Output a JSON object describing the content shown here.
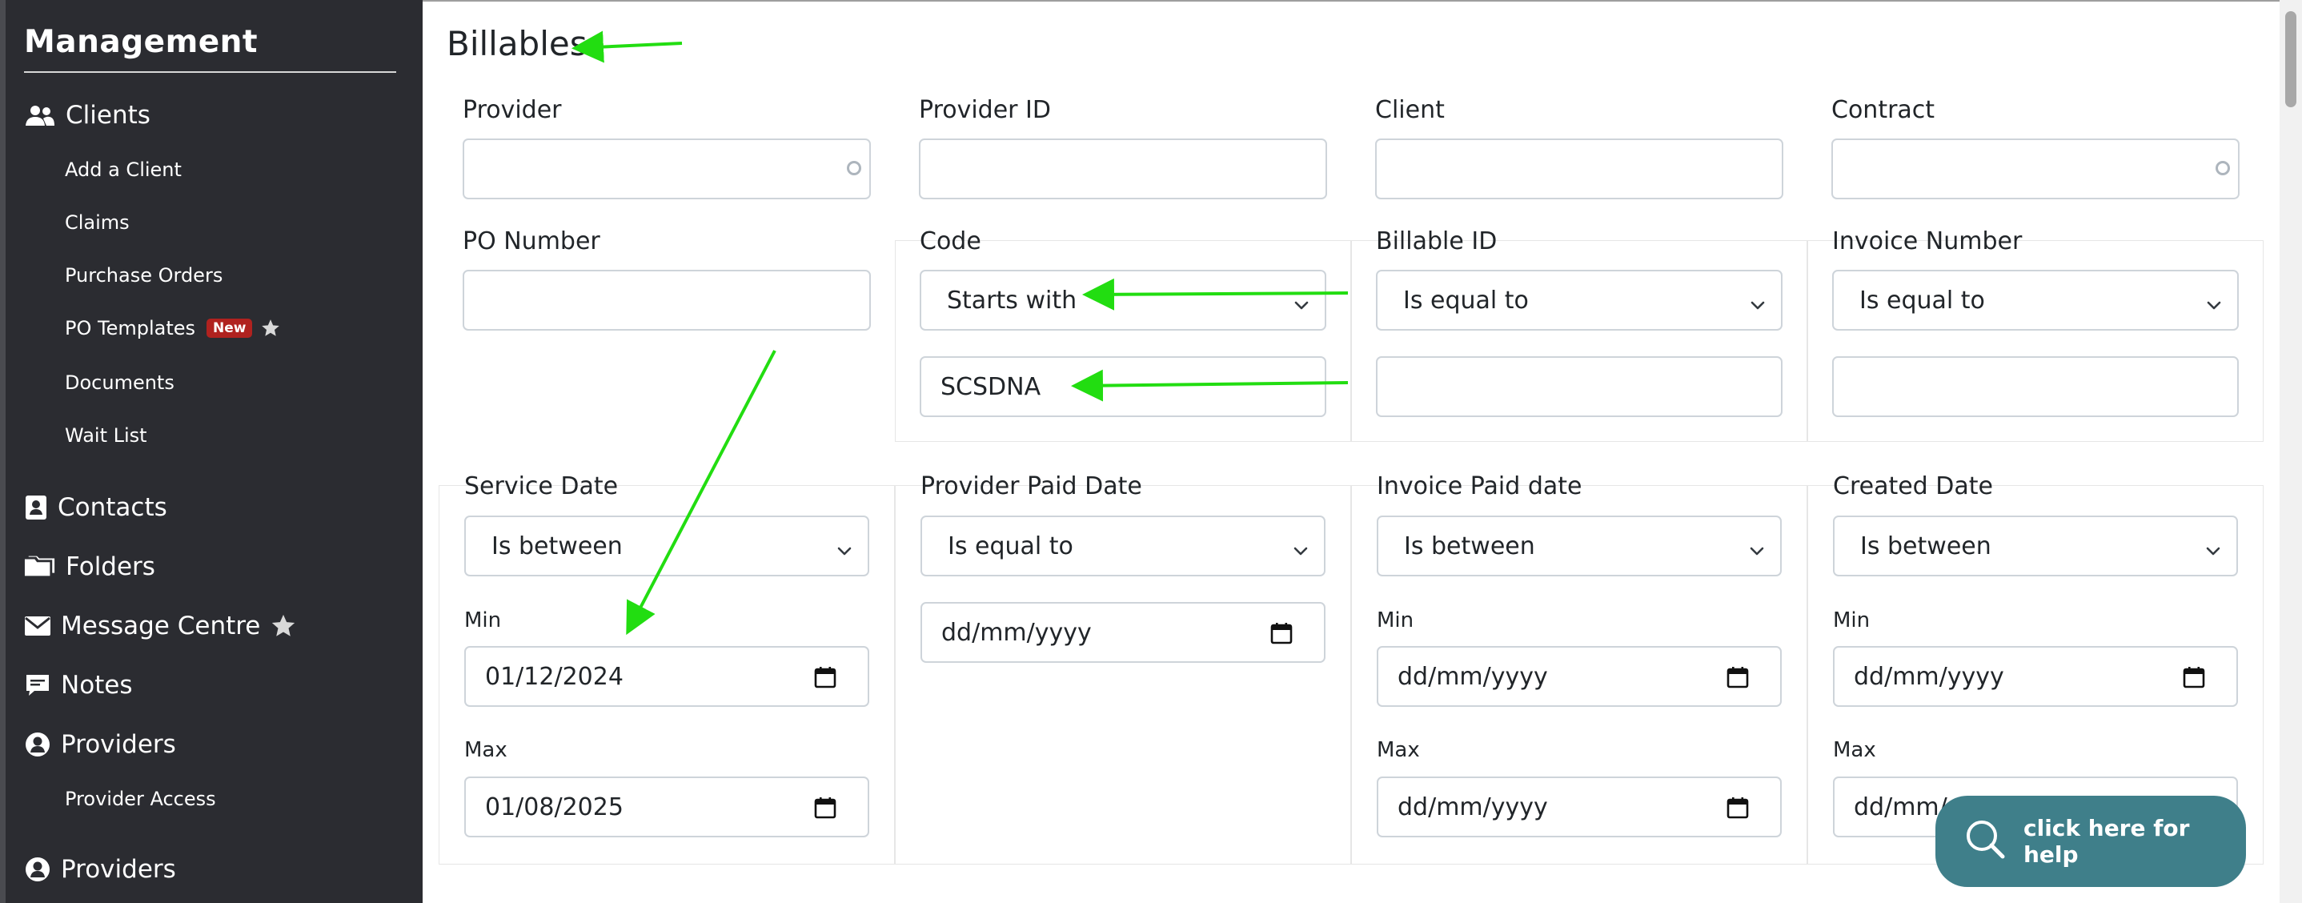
{
  "sidebar": {
    "brand": "Management",
    "nav": [
      {
        "label": "Clients",
        "icon": "users-icon"
      },
      {
        "label": "Contacts",
        "icon": "contact-card-icon"
      },
      {
        "label": "Folders",
        "icon": "folders-icon"
      },
      {
        "label": "Message Centre",
        "icon": "envelope-icon"
      },
      {
        "label": "Notes",
        "icon": "note-icon"
      },
      {
        "label": "Providers",
        "icon": "user-circle-icon"
      },
      {
        "label": "Providers",
        "icon": "user-circle-icon"
      }
    ],
    "client_sub": [
      "Add a Client",
      "Claims",
      "Purchase Orders",
      "PO Templates",
      "Documents",
      "Wait List"
    ],
    "new_badge": "New",
    "provider_sub": [
      "Provider Access"
    ]
  },
  "page": {
    "title": "Billables"
  },
  "filters": {
    "provider": {
      "label": "Provider",
      "value": ""
    },
    "provider_id": {
      "label": "Provider ID",
      "value": ""
    },
    "client": {
      "label": "Client",
      "value": ""
    },
    "contract": {
      "label": "Contract",
      "value": ""
    },
    "po_number": {
      "label": "PO Number",
      "value": ""
    },
    "code": {
      "label": "Code",
      "operator": "Starts with",
      "value": "SCSDNA"
    },
    "billable_id": {
      "label": "Billable ID",
      "operator": "Is equal to",
      "value": ""
    },
    "invoice_number": {
      "label": "Invoice Number",
      "operator": "Is equal to",
      "value": ""
    },
    "service_date": {
      "label": "Service Date",
      "operator": "Is between",
      "min_label": "Min",
      "min": "01/12/2024",
      "max_label": "Max",
      "max": "01/08/2025"
    },
    "provider_paid_date": {
      "label": "Provider Paid Date",
      "operator": "Is equal to",
      "value": "dd/mm/yyyy"
    },
    "invoice_paid_date": {
      "label": "Invoice Paid date",
      "operator": "Is between",
      "min_label": "Min",
      "min": "dd/mm/yyyy",
      "max_label": "Max",
      "max": "dd/mm/yyyy"
    },
    "created_date": {
      "label": "Created Date",
      "operator": "Is between",
      "min_label": "Min",
      "min": "dd/mm/yyyy",
      "max_label": "Max",
      "max": "dd/mm/"
    }
  },
  "help": {
    "label": "click here for help"
  },
  "colors": {
    "sidebar_bg": "#2b2c31",
    "arrow": "#22dd11",
    "help_bg": "#3f7f8a",
    "badge": "#b0221f"
  }
}
